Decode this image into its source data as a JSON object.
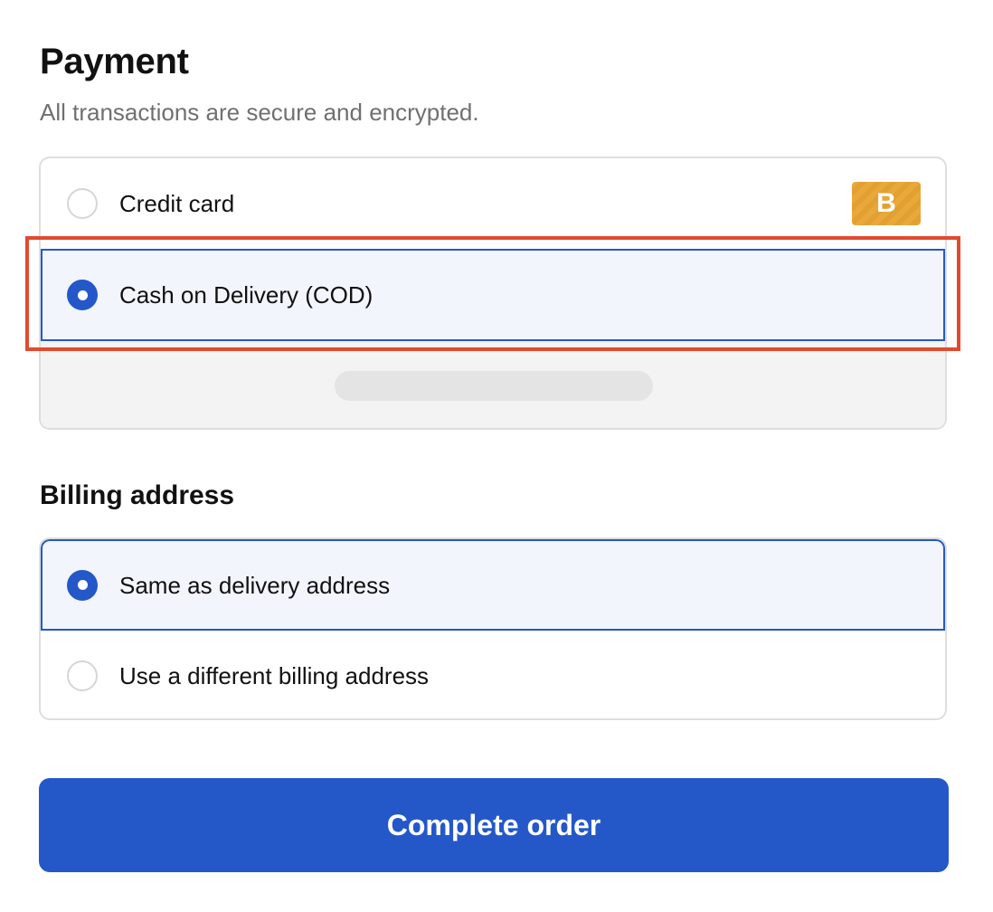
{
  "payment": {
    "title": "Payment",
    "subtitle": "All transactions are secure and encrypted.",
    "options": [
      {
        "label": "Credit card",
        "selected": false,
        "badge": "B",
        "badge_color": "#e8a83a"
      },
      {
        "label": "Cash on Delivery (COD)",
        "selected": true
      }
    ]
  },
  "billing": {
    "title": "Billing address",
    "options": [
      {
        "label": "Same as delivery address",
        "selected": true
      },
      {
        "label": "Use a different billing address",
        "selected": false
      }
    ]
  },
  "actions": {
    "complete_label": "Complete order"
  },
  "colors": {
    "accent": "#2458c9",
    "selected_bg": "#f3f5fd",
    "highlight": "#e24a2e"
  }
}
